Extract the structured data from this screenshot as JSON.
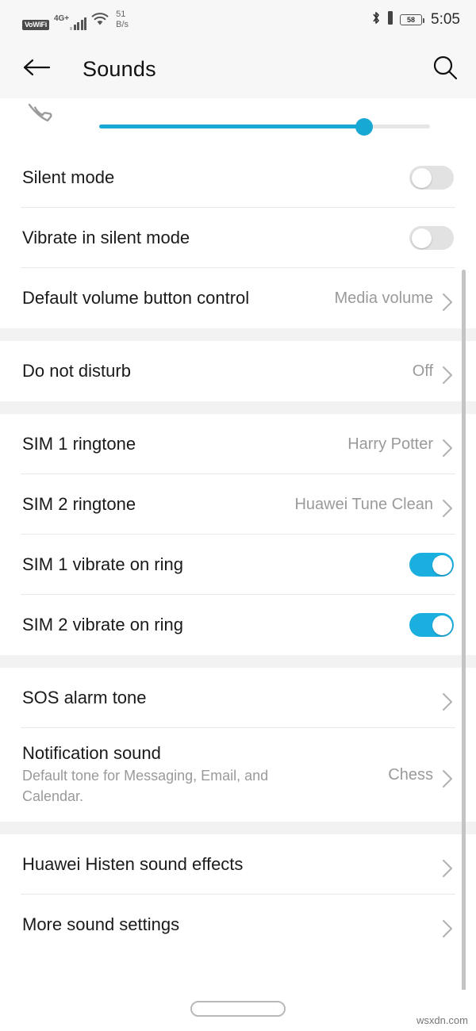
{
  "status_bar": {
    "vowifi_badge": "VoWiFi",
    "network_type": "4G+",
    "signal_icon": "signal-bars-icon",
    "wifi_icon": "wifi-icon",
    "network_speed_value": "51",
    "network_speed_unit": "B/s",
    "bluetooth_icon": "bluetooth-icon",
    "vibrate_icon": "vibrate-icon",
    "battery_percent": "58",
    "time": "5:05"
  },
  "app_bar": {
    "back_icon": "back-arrow-icon",
    "title": "Sounds",
    "search_icon": "search-icon"
  },
  "volume_slider": {
    "icon": "phone-handset-icon",
    "label": "Ringtone volume",
    "value_percent": 80,
    "fill_color": "#17a9d4",
    "track_color": "#e6e6e6"
  },
  "sections": [
    {
      "rows": [
        {
          "label": "Silent mode",
          "type": "toggle",
          "state": "off"
        },
        {
          "label": "Vibrate in silent mode",
          "type": "toggle",
          "state": "off"
        },
        {
          "label": "Default volume button control",
          "type": "nav",
          "value": "Media volume"
        }
      ]
    },
    {
      "rows": [
        {
          "label": "Do not disturb",
          "type": "nav",
          "value": "Off"
        }
      ]
    },
    {
      "rows": [
        {
          "label": "SIM 1 ringtone",
          "type": "nav",
          "value": "Harry Potter"
        },
        {
          "label": "SIM 2 ringtone",
          "type": "nav",
          "value": "Huawei Tune Clean"
        },
        {
          "label": "SIM 1 vibrate on ring",
          "type": "toggle",
          "state": "on"
        },
        {
          "label": "SIM 2 vibrate on ring",
          "type": "toggle",
          "state": "on"
        }
      ]
    },
    {
      "rows": [
        {
          "label": "SOS alarm tone",
          "type": "nav",
          "value": ""
        },
        {
          "label": "Notification sound",
          "sublabel": "Default tone for Messaging, Email, and Calendar.",
          "type": "nav",
          "value": "Chess"
        }
      ]
    },
    {
      "rows": [
        {
          "label": "Huawei Histen sound effects",
          "type": "nav",
          "value": ""
        },
        {
          "label": "More sound settings",
          "type": "nav",
          "value": ""
        }
      ]
    }
  ],
  "nav_bar": {
    "home_indicator": "home-indicator-pill"
  },
  "watermark": "wsxdn.com",
  "colors": {
    "accent": "#17a9d4",
    "toggle_on": "#1bafe0",
    "toggle_off": "#e2e2e2",
    "section_gap": "#f2f2f2",
    "bar_background": "#f7f7f7"
  }
}
